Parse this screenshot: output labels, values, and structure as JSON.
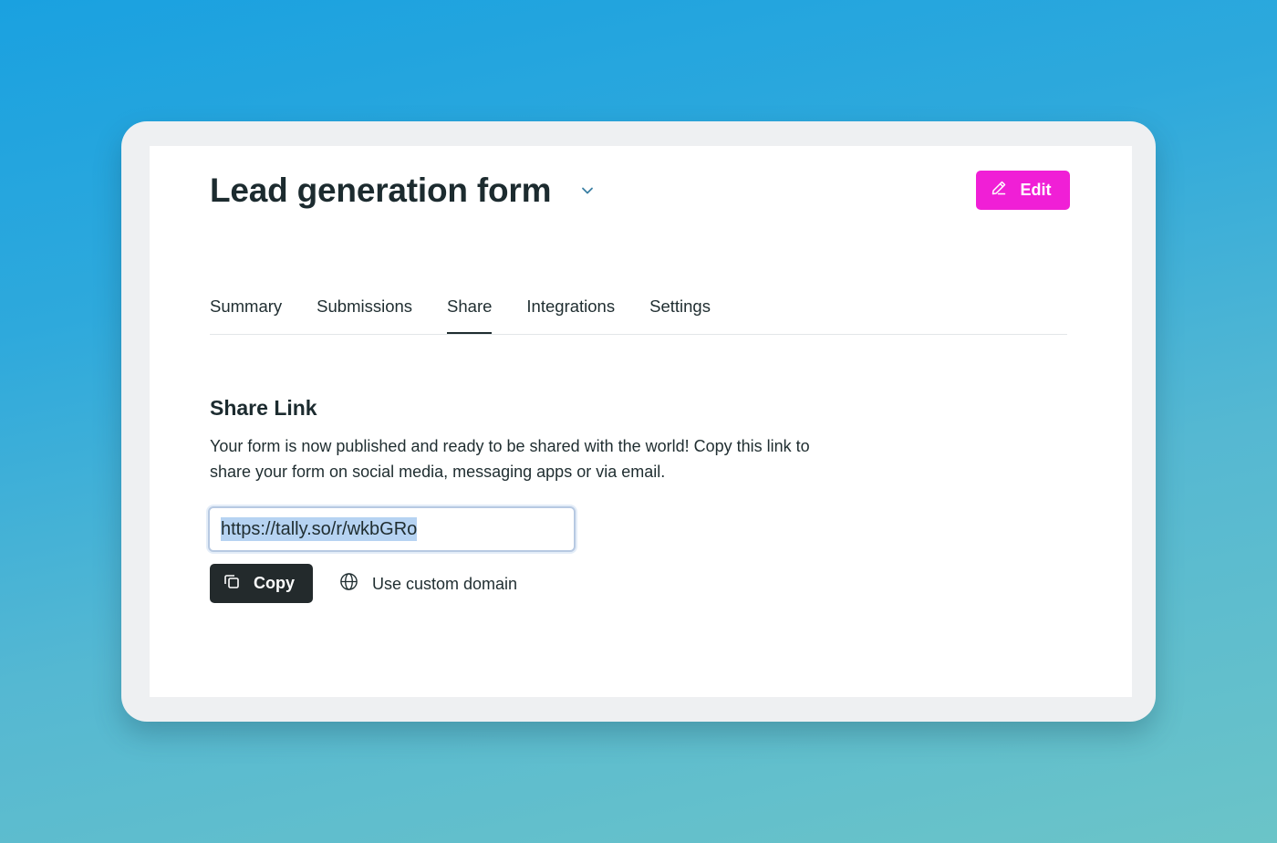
{
  "header": {
    "form_title": "Lead generation form",
    "title_menu_icon": "chevron-down-icon",
    "edit_label": "Edit",
    "edit_icon": "pencil-icon",
    "edit_color": "#f01fd6"
  },
  "tabs": [
    {
      "label": "Summary",
      "active": false
    },
    {
      "label": "Submissions",
      "active": false
    },
    {
      "label": "Share",
      "active": true
    },
    {
      "label": "Integrations",
      "active": false
    },
    {
      "label": "Settings",
      "active": false
    }
  ],
  "share": {
    "heading": "Share Link",
    "description": "Your form is now published and ready to be shared with the world! Copy this link to share your form on social media, messaging apps or via email.",
    "link_value": "https://tally.so/r/wkbGRo",
    "copy_label": "Copy",
    "copy_icon": "copy-icon",
    "custom_domain_label": "Use custom domain",
    "custom_domain_icon": "globe-icon"
  }
}
